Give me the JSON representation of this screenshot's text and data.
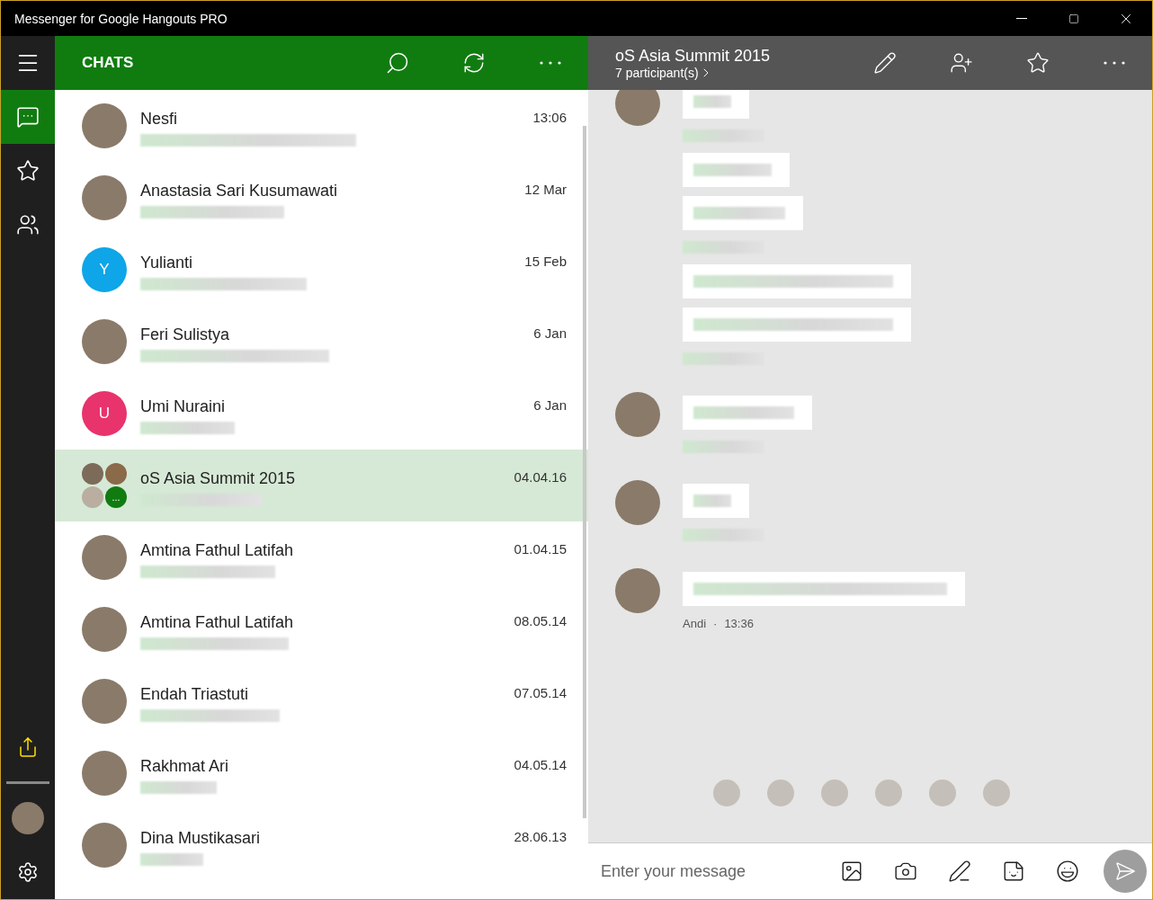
{
  "window": {
    "title": "Messenger for Google Hangouts PRO"
  },
  "rail": {
    "items": [
      {
        "kind": "chats",
        "selected": true
      },
      {
        "kind": "favorites",
        "selected": false
      },
      {
        "kind": "contacts",
        "selected": false
      }
    ]
  },
  "chat_list": {
    "title": "CHATS",
    "rows": [
      {
        "name": "Nesfi",
        "time": "13:06",
        "avatar": {
          "kind": "photo"
        },
        "selected": false
      },
      {
        "name": "Anastasia Sari Kusumawati",
        "time": "12 Mar",
        "avatar": {
          "kind": "photo"
        },
        "selected": false
      },
      {
        "name": "Yulianti",
        "time": "15 Feb",
        "avatar": {
          "kind": "letter",
          "letter": "Y",
          "color": "#0ea5e9"
        },
        "selected": false
      },
      {
        "name": "Feri Sulistya",
        "time": "6 Jan",
        "avatar": {
          "kind": "photo"
        },
        "selected": false
      },
      {
        "name": "Umi Nuraini",
        "time": "6 Jan",
        "avatar": {
          "kind": "letter",
          "letter": "U",
          "color": "#e8336d"
        },
        "selected": false
      },
      {
        "name": "oS Asia Summit 2015",
        "time": "04.04.16",
        "avatar": {
          "kind": "group",
          "more": "..."
        },
        "selected": true
      },
      {
        "name": "Amtina Fathul Latifah",
        "time": "01.04.15",
        "avatar": {
          "kind": "photo"
        },
        "selected": false
      },
      {
        "name": "Amtina Fathul Latifah",
        "time": "08.05.14",
        "avatar": {
          "kind": "photo"
        },
        "selected": false
      },
      {
        "name": "Endah Triastuti",
        "time": "07.05.14",
        "avatar": {
          "kind": "photo"
        },
        "selected": false
      },
      {
        "name": "Rakhmat Ari",
        "time": "04.05.14",
        "avatar": {
          "kind": "photo"
        },
        "selected": false
      },
      {
        "name": "Dina Mustikasari",
        "time": "28.06.13",
        "avatar": {
          "kind": "photo"
        },
        "selected": false
      }
    ]
  },
  "conversation": {
    "title": "oS Asia Summit 2015",
    "subtitle": "7 participant(s)",
    "groups": [
      {
        "items": [
          {
            "kind": "bubble"
          },
          {
            "kind": "meta"
          },
          {
            "kind": "bubble"
          },
          {
            "kind": "bubble"
          },
          {
            "kind": "meta"
          },
          {
            "kind": "bubble"
          },
          {
            "kind": "bubble"
          },
          {
            "kind": "meta"
          }
        ]
      },
      {
        "items": [
          {
            "kind": "bubble"
          },
          {
            "kind": "meta"
          }
        ]
      },
      {
        "items": [
          {
            "kind": "bubble"
          },
          {
            "kind": "meta"
          }
        ]
      },
      {
        "items": [
          {
            "kind": "bubble"
          },
          {
            "kind": "meta",
            "sender": "Andi",
            "separator": "·",
            "time": "13:36"
          }
        ]
      }
    ],
    "seen_by": [
      {
        "kind": "photo"
      },
      {
        "kind": "photo"
      },
      {
        "kind": "photo"
      },
      {
        "kind": "photo"
      },
      {
        "kind": "photo"
      },
      {
        "kind": "photo"
      }
    ],
    "compose": {
      "placeholder": "Enter your message"
    }
  }
}
